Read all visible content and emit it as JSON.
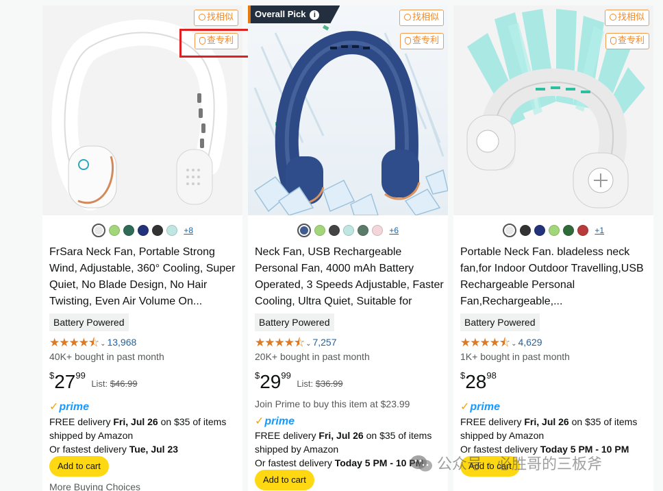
{
  "tools": {
    "find_similar": "找相似",
    "check_patent": "查专利"
  },
  "cards": [
    {
      "swatches": [
        "#e8e8e8",
        "#a3d67a",
        "#2f6b57",
        "#22337a",
        "#333333",
        "#bfe6e2"
      ],
      "more": "+8",
      "title": "FrSara Neck Fan, Portable Strong Wind, Adjustable, 360° Cooling, Super Quiet, No Blade Design, No Hair Twisting, Even Air Volume On...",
      "tag": "Battery Powered",
      "rating": 4.5,
      "count": "13,968",
      "bought": "40K+ bought in past month",
      "price": {
        "currency": "$",
        "whole": "27",
        "fraction": "99",
        "list_label": "List:",
        "list": "$46.99"
      },
      "prime": "prime",
      "delivery": [
        "FREE delivery ",
        "Fri, Jul 26",
        " on $35 of items"
      ],
      "shipped": "shipped by Amazon",
      "fastest": [
        "Or fastest delivery ",
        "Tue, Jul 23"
      ],
      "cart": "Add to cart",
      "more_choices": "More Buying Choices"
    },
    {
      "badge": "Overall Pick",
      "swatches": [
        "#3f5b8f",
        "#a3d67a",
        "#444444",
        "#bfe6e2",
        "#5a7a6a",
        "#f2d6da"
      ],
      "more": "+6",
      "title": "Neck Fan, USB Rechargeable Personal Fan, 4000 mAh Battery Operated, 3 Speeds Adjustable, Faster Cooling, Ultra Quiet, Suitable for Home,...",
      "tag": "Battery Powered",
      "rating": 4.5,
      "count": "7,257",
      "bought": "20K+ bought in past month",
      "price": {
        "currency": "$",
        "whole": "29",
        "fraction": "99",
        "list_label": "List:",
        "list": "$36.99"
      },
      "join": "Join Prime to buy this item at $23.99",
      "prime": "prime",
      "delivery": [
        "FREE delivery ",
        "Fri, Jul 26",
        " on $35 of items"
      ],
      "shipped": "shipped by Amazon",
      "fastest": [
        "Or fastest delivery ",
        "Today 5 PM - 10 PM"
      ],
      "cart": "Add to cart"
    },
    {
      "swatches": [
        "#e8e8e8",
        "#333333",
        "#22337a",
        "#a3d67a",
        "#2f6b3a",
        "#b83a3a"
      ],
      "more": "+1",
      "title": "Portable Neck Fan. bladeless neck fan,for Indoor Outdoor Travelling,USB Rechargeable Personal Fan,Rechargeable,...",
      "tag": "Battery Powered",
      "rating": 4.5,
      "count": "4,629",
      "bought": "1K+ bought in past month",
      "price": {
        "currency": "$",
        "whole": "28",
        "fraction": "98"
      },
      "prime": "prime",
      "delivery": [
        "FREE delivery ",
        "Fri, Jul 26",
        " on $35 of items"
      ],
      "shipped": "shipped by Amazon",
      "fastest": [
        "Or fastest delivery ",
        "Today 5 PM - 10 PM"
      ],
      "cart": "Add to cart"
    }
  ],
  "stars_glyph": "★★★★⯪",
  "watermark": "公众号 · 必胜哥的三板斧",
  "colors": {
    "accent": "#ffd814",
    "link": "#2162a1",
    "star": "#de7921",
    "prime": "#1399ff",
    "highlight": "#e02020"
  }
}
